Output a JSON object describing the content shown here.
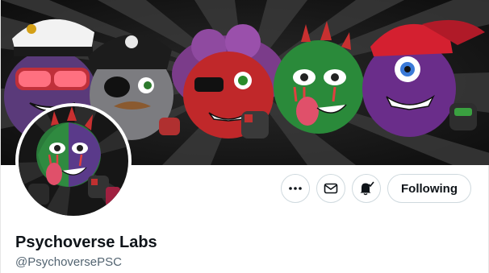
{
  "profile": {
    "display_name": "Psychoverse Labs",
    "handle": "@PsychoversePSC"
  },
  "actions": {
    "more_icon": "ellipsis-icon",
    "message_icon": "envelope-icon",
    "notify_icon": "bell-check-icon",
    "follow_label": "Following"
  },
  "colors": {
    "text_primary": "#0f1419",
    "text_secondary": "#536471",
    "button_border": "#cfd9de"
  }
}
